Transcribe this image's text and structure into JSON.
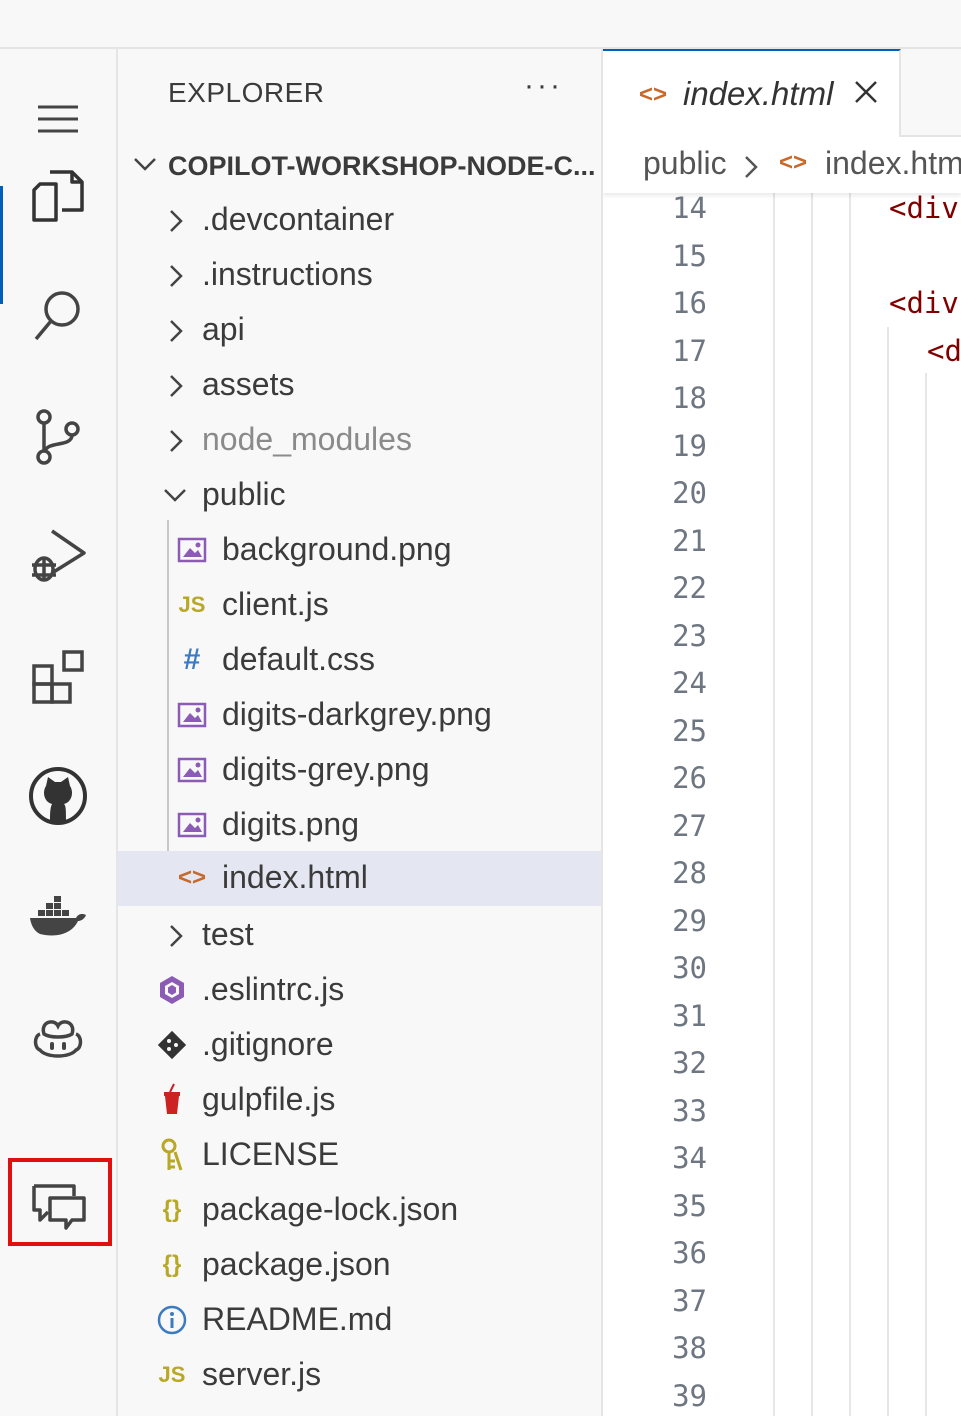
{
  "activity_bar": {
    "items": [
      {
        "name": "explorer-icon"
      },
      {
        "name": "search-icon"
      },
      {
        "name": "source-control-icon"
      },
      {
        "name": "run-debug-icon"
      },
      {
        "name": "extensions-icon"
      },
      {
        "name": "github-icon"
      },
      {
        "name": "docker-icon"
      },
      {
        "name": "copilot-icon"
      },
      {
        "name": "chat-icon"
      }
    ]
  },
  "explorer": {
    "header": "EXPLORER",
    "more": "···",
    "root": "COPILOT-WORKSHOP-NODE-C...",
    "tree": [
      {
        "label": ".devcontainer"
      },
      {
        "label": ".instructions"
      },
      {
        "label": "api"
      },
      {
        "label": "assets"
      },
      {
        "label": "node_modules"
      },
      {
        "label": "public"
      },
      {
        "label": "background.png"
      },
      {
        "label": "client.js",
        "icon_text": "JS"
      },
      {
        "label": "default.css",
        "icon_text": "#"
      },
      {
        "label": "digits-darkgrey.png"
      },
      {
        "label": "digits-grey.png"
      },
      {
        "label": "digits.png"
      },
      {
        "label": "index.html",
        "icon_text": "<>"
      },
      {
        "label": "test"
      },
      {
        "label": ".eslintrc.js"
      },
      {
        "label": ".gitignore"
      },
      {
        "label": "gulpfile.js"
      },
      {
        "label": "LICENSE"
      },
      {
        "label": "package-lock.json",
        "icon_text": "{}"
      },
      {
        "label": "package.json",
        "icon_text": "{}"
      },
      {
        "label": "README.md"
      },
      {
        "label": "server.js",
        "icon_text": "JS"
      }
    ]
  },
  "editor": {
    "tab": {
      "label": "index.html",
      "icon_text": "<>"
    },
    "breadcrumb": {
      "folder": "public",
      "file": "index.htm",
      "file_icon": "<>"
    },
    "line_numbers": [
      "14",
      "15",
      "16",
      "17",
      "18",
      "19",
      "20",
      "21",
      "22",
      "23",
      "24",
      "25",
      "26",
      "27",
      "28",
      "29",
      "30",
      "31",
      "32",
      "33",
      "34",
      "35",
      "36",
      "37",
      "38",
      "39"
    ],
    "code_lines": [
      {
        "line": "14",
        "text": "<div"
      },
      {
        "line": "16",
        "text": "<div"
      },
      {
        "line": "17",
        "text": "<d"
      }
    ]
  },
  "colors": {
    "accent": "#005fb8",
    "highlight_box": "#e01010",
    "selected_row": "#e4e6f1",
    "html_icon": "#c8692c",
    "image_icon": "#8b5bb5",
    "js_icon": "#b8a826",
    "css_icon": "#3b7bbf",
    "tag_color": "#800000"
  }
}
